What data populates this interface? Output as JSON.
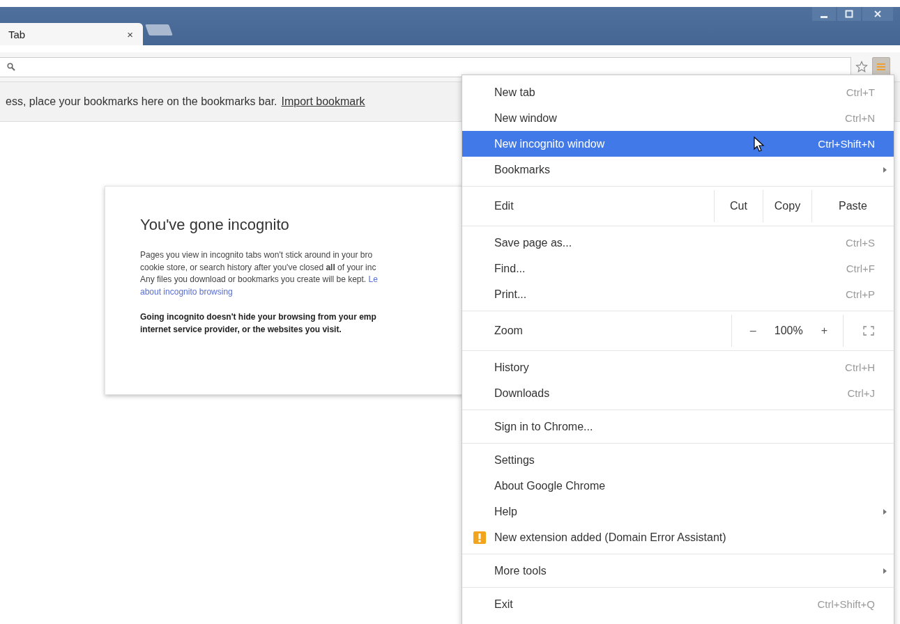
{
  "tab": {
    "title": "Tab",
    "close": "×"
  },
  "bookmarks_bar": {
    "text": "ess, place your bookmarks here on the bookmarks bar.",
    "link": "Import bookmark"
  },
  "card": {
    "title": "You've gone incognito",
    "lines": [
      {
        "text": "Pages you view in incognito tabs won't stick around in your bro"
      },
      {
        "text": "cookie store, or search history after you've closed **all** of your inc"
      },
      {
        "text": "Any files you download or bookmarks you create will be kept.",
        "link": "Le"
      },
      {
        "link": "about incognito browsing"
      }
    ],
    "warning_lines": [
      "Going incognito doesn't hide your browsing from your emp",
      "internet service provider, or the websites you visit."
    ]
  },
  "menu": {
    "items": [
      {
        "kind": "item",
        "label": "New tab",
        "shortcut": "Ctrl+T",
        "highlighted": false,
        "submenu": false
      },
      {
        "kind": "item",
        "label": "New window",
        "shortcut": "Ctrl+N",
        "highlighted": false,
        "submenu": false
      },
      {
        "kind": "item",
        "label": "New incognito window",
        "shortcut": "Ctrl+Shift+N",
        "highlighted": true,
        "submenu": false
      },
      {
        "kind": "item",
        "label": "Bookmarks",
        "highlighted": false,
        "submenu": true
      },
      {
        "kind": "separator"
      },
      {
        "kind": "edit",
        "label": "Edit",
        "buttons": [
          "Cut",
          "Copy",
          "Paste"
        ]
      },
      {
        "kind": "separator"
      },
      {
        "kind": "item",
        "label": "Save page as...",
        "shortcut": "Ctrl+S",
        "highlighted": false,
        "submenu": false
      },
      {
        "kind": "item",
        "label": "Find...",
        "shortcut": "Ctrl+F",
        "highlighted": false,
        "submenu": false
      },
      {
        "kind": "item",
        "label": "Print...",
        "shortcut": "Ctrl+P",
        "highlighted": false,
        "submenu": false
      },
      {
        "kind": "separator"
      },
      {
        "kind": "zoom",
        "label": "Zoom",
        "minus": "–",
        "value": "100%",
        "plus": "+"
      },
      {
        "kind": "separator"
      },
      {
        "kind": "item",
        "label": "History",
        "shortcut": "Ctrl+H",
        "highlighted": false,
        "submenu": false
      },
      {
        "kind": "item",
        "label": "Downloads",
        "shortcut": "Ctrl+J",
        "highlighted": false,
        "submenu": false
      },
      {
        "kind": "separator"
      },
      {
        "kind": "item",
        "label": "Sign in to Chrome...",
        "highlighted": false,
        "submenu": false
      },
      {
        "kind": "separator"
      },
      {
        "kind": "item",
        "label": "Settings",
        "highlighted": false,
        "submenu": false
      },
      {
        "kind": "item",
        "label": "About Google Chrome",
        "highlighted": false,
        "submenu": false
      },
      {
        "kind": "item",
        "label": "Help",
        "highlighted": false,
        "submenu": true
      },
      {
        "kind": "notice",
        "label": "New extension added (Domain Error Assistant)",
        "highlighted": false
      },
      {
        "kind": "separator"
      },
      {
        "kind": "item",
        "label": "More tools",
        "highlighted": false,
        "submenu": true
      },
      {
        "kind": "separator"
      },
      {
        "kind": "item",
        "label": "Exit",
        "shortcut": "Ctrl+Shift+Q",
        "highlighted": false,
        "submenu": false
      }
    ]
  }
}
